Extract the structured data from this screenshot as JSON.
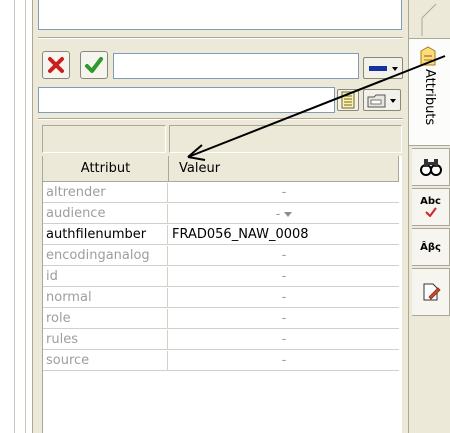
{
  "toolbar": {
    "cancel_icon": "red-x-icon",
    "ok_icon": "green-check-icon",
    "value_field": "",
    "path_field": ""
  },
  "table": {
    "headers": [
      "Attribut",
      "Valeur"
    ],
    "rows": [
      {
        "name": "altrender",
        "value": "-",
        "active": false
      },
      {
        "name": "audience",
        "value": "-",
        "active": false,
        "dropdown": true
      },
      {
        "name": "authfilenumber",
        "value": "FRAD056_NAW_0008",
        "active": true
      },
      {
        "name": "encodinganalog",
        "value": "-",
        "active": false
      },
      {
        "name": "id",
        "value": "-",
        "active": false
      },
      {
        "name": "normal",
        "value": "-",
        "active": false
      },
      {
        "name": "role",
        "value": "-",
        "active": false
      },
      {
        "name": "rules",
        "value": "-",
        "active": false
      },
      {
        "name": "source",
        "value": "-",
        "active": false
      }
    ]
  },
  "sidebar": {
    "attr_tab_label": "Attributs",
    "tabs": [
      "binoculars-icon",
      "spellcheck-icon",
      "charset-icon",
      "edit-document-icon"
    ],
    "spell_label": "Abc",
    "charset_label": "Âβς"
  },
  "colors": {
    "panel": "#ece9d8",
    "cancel": "#c8211d",
    "ok": "#2f9a2c",
    "color_swatch": "#1233a0"
  }
}
